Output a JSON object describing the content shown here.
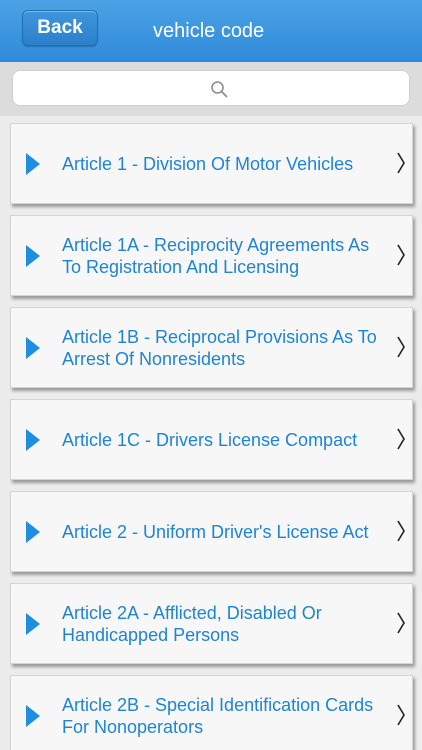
{
  "header": {
    "back_label": "Back",
    "title": "vehicle code"
  },
  "search": {
    "placeholder": "",
    "icon": "search-icon"
  },
  "articles": [
    {
      "label": "Article 1 - Division Of Motor Vehicles"
    },
    {
      "label": "Article 1A - Reciprocity Agreements As To Registration And Licensing"
    },
    {
      "label": "Article 1B - Reciprocal Provisions As To Arrest Of Nonresidents"
    },
    {
      "label": "Article 1C - Drivers License Compact"
    },
    {
      "label": "Article 2 - Uniform Driver's License Act"
    },
    {
      "label": "Article 2A - Afflicted, Disabled Or Handicapped Persons"
    },
    {
      "label": "Article 2B - Special Identification Cards For Nonoperators"
    }
  ],
  "colors": {
    "nav_bar": "#3a94dd",
    "accent_text": "#1e84d6",
    "triangle": "#1e8ee0",
    "background": "#ececec"
  }
}
